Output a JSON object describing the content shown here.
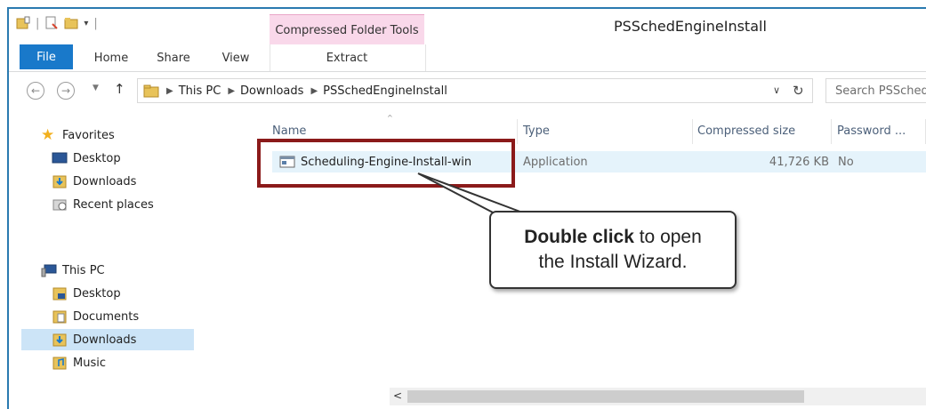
{
  "window": {
    "title": "PSSchedEngineInstall",
    "context_tab": "Compressed Folder Tools"
  },
  "ribbon": {
    "tabs": [
      "File",
      "Home",
      "Share",
      "View"
    ],
    "extract": "Extract"
  },
  "address": {
    "crumbs": [
      "This PC",
      "Downloads",
      "PSSchedEngineInstall"
    ],
    "search_placeholder": "Search PSSched"
  },
  "nav": {
    "favorites": "Favorites",
    "favorites_items": [
      "Desktop",
      "Downloads",
      "Recent places"
    ],
    "this_pc": "This PC",
    "pc_items": [
      "Desktop",
      "Documents",
      "Downloads",
      "Music"
    ]
  },
  "columns": {
    "name": "Name",
    "type": "Type",
    "compressed_size": "Compressed size",
    "password": "Password ..."
  },
  "files": [
    {
      "name": "Scheduling-Engine-Install-win",
      "type": "Application",
      "size": "41,726 KB",
      "password": "No"
    }
  ],
  "annotation": {
    "bold": "Double click",
    "rest1": " to open",
    "line2": "the Install Wizard."
  },
  "colors": {
    "accent": "#1979ca",
    "highlight_border": "#8b1a1a",
    "context_tab_bg": "#f9d8ea"
  }
}
